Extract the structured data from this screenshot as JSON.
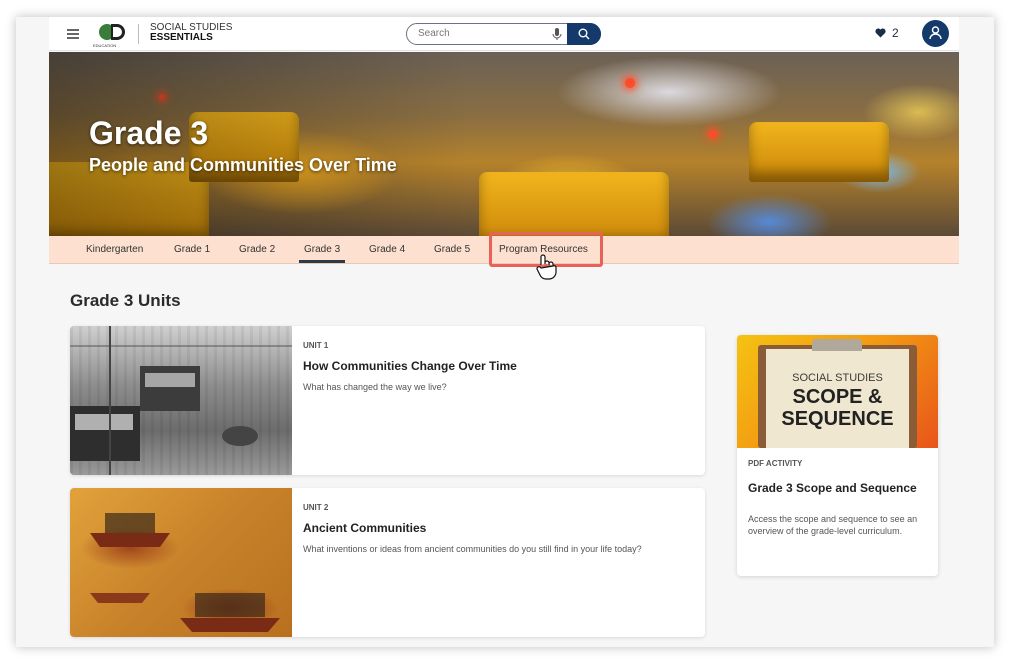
{
  "header": {
    "logo_text_line1": "SOCIAL STUDIES",
    "logo_text_line2": "ESSENTIALS",
    "logo_sub": "EDUCATION",
    "search_placeholder": "Search",
    "favorites_count": "2"
  },
  "hero": {
    "title": "Grade 3",
    "subtitle": "People and Communities Over Time"
  },
  "grade_tabs": [
    {
      "label": "Kindergarten",
      "active": false
    },
    {
      "label": "Grade 1",
      "active": false
    },
    {
      "label": "Grade 2",
      "active": false
    },
    {
      "label": "Grade 3",
      "active": true
    },
    {
      "label": "Grade 4",
      "active": false
    },
    {
      "label": "Grade 5",
      "active": false
    },
    {
      "label": "Program Resources",
      "active": false,
      "highlighted": true
    }
  ],
  "main": {
    "section_title": "Grade 3 Units",
    "units": [
      {
        "label": "UNIT 1",
        "title": "How Communities Change Over Time",
        "description": "What has changed the way we live?"
      },
      {
        "label": "UNIT 2",
        "title": "Ancient Communities",
        "description": "What inventions or ideas from ancient communities do you still find in your life today?"
      }
    ]
  },
  "sidebar_card": {
    "image_line1": "SOCIAL STUDIES",
    "image_line2": "SCOPE &",
    "image_line3": "SEQUENCE",
    "label": "PDF ACTIVITY",
    "title": "Grade 3 Scope and Sequence",
    "description": "Access the scope and sequence to see an overview of the grade-level curriculum."
  },
  "colors": {
    "navy": "#143a6b",
    "tab_bar": "#fde0cf",
    "highlight": "#e8625a"
  }
}
